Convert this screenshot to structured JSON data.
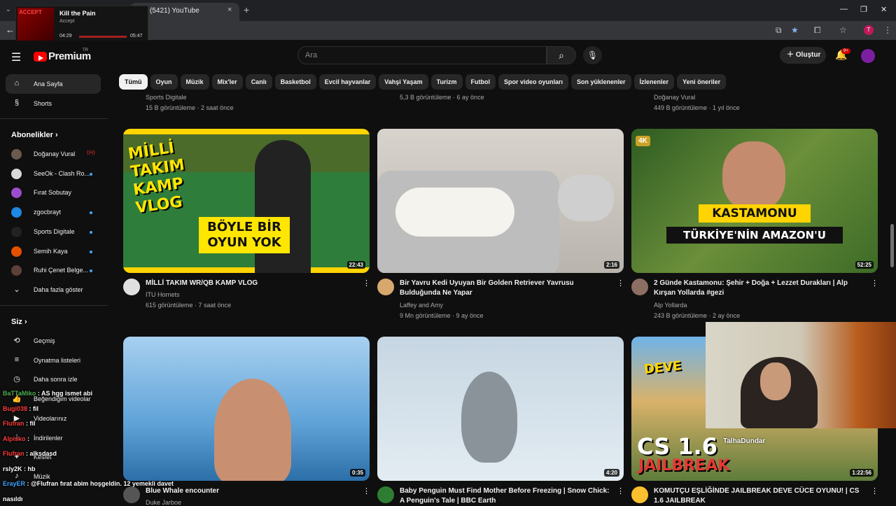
{
  "browser": {
    "tab_title": "(5421) YouTube",
    "tab_close": "×",
    "new_tab": "+",
    "window_minimize": "—",
    "window_restore": "❐",
    "window_close": "✕"
  },
  "now_playing": {
    "title": "Kill the Pain",
    "artist": "Accept",
    "elapsed": "04:29",
    "total": "05:47",
    "art_text": "ACCEPT",
    "progress_fraction": 0.77
  },
  "header": {
    "logo_text": "Premium",
    "logo_sup": "TR",
    "search_placeholder": "Ara",
    "create_label": "Oluştur",
    "notif_count": "9+"
  },
  "sidebar": {
    "main": [
      {
        "label": "Ana Sayfa",
        "icon": "home-icon"
      },
      {
        "label": "Shorts",
        "icon": "shorts-icon"
      }
    ],
    "subs_header": "Abonelikler",
    "subscriptions": [
      {
        "label": "Doğanay Vural",
        "status": "live",
        "color": "#6b5b4f"
      },
      {
        "label": "SeeOk - Clash Ro...",
        "status": "new",
        "color": "#d9d9d9"
      },
      {
        "label": "Fırat Sobutay",
        "status": "",
        "color": "#9c4dcc"
      },
      {
        "label": "zgocbrayt",
        "status": "new",
        "color": "#1e88e5"
      },
      {
        "label": "Sports Digitale",
        "status": "new",
        "color": "#222"
      },
      {
        "label": "Semih Kaya",
        "status": "new",
        "color": "#e65100"
      },
      {
        "label": "Ruhi Çenet Belge...",
        "status": "new",
        "color": "#5d4037"
      }
    ],
    "show_more": "Daha fazla göster",
    "you_header": "Siz",
    "you_items": [
      {
        "label": "Geçmiş",
        "icon": "history-icon"
      },
      {
        "label": "Oynatma listeleri",
        "icon": "playlist-icon"
      },
      {
        "label": "Daha sonra izle",
        "icon": "watch-later-icon"
      },
      {
        "label": "Beğendiğim videolar",
        "icon": "like-icon"
      },
      {
        "label": "Videolarınız",
        "icon": "video-icon"
      },
      {
        "label": "İndirilenler",
        "icon": "download-icon"
      },
      {
        "label": "Kesfet",
        "icon": "explore-icon"
      },
      {
        "label": "Müzik",
        "icon": "music-icon"
      }
    ]
  },
  "chips": [
    "Tümü",
    "Oyun",
    "Müzik",
    "Mix'ler",
    "Canlı",
    "Basketbol",
    "Evcil hayvanlar",
    "Vahşi Yaşam",
    "Turizm",
    "Futbol",
    "Spor video oyunları",
    "Son yüklenenler",
    "İzlenenler",
    "Yeni öneriler"
  ],
  "partial_top_row": [
    {
      "channel": "Sports Digitale",
      "meta": "15 B görüntüleme · 2 saat önce"
    },
    {
      "channel": "",
      "meta": "5,3 B görüntüleme · 6 ay önce"
    },
    {
      "channel": "Doğanay Vural",
      "meta": "449 B görüntüleme · 1 yıl önce"
    }
  ],
  "videos": [
    {
      "title": "MİLLİ TAKIM WR/QB KAMP VLOG",
      "channel": "ITU Hornets",
      "meta": "615 görüntüleme · 7 saat önce",
      "duration": "22:43",
      "thumb_text": "MİLLİ TAKIM KAMP VLOG",
      "thumb_text2": "BÖYLE BİR OYUN YOK",
      "avatar_color": "#e0e0e0"
    },
    {
      "title": "Bir Yavru Kedi Uyuyan Bir Golden Retriever Yavrusu Bulduğunda Ne Yapar",
      "channel": "Laffey and Amy",
      "meta": "9 Mn görüntüleme · 9 ay önce",
      "duration": "2:16",
      "avatar_color": "#d7a86e"
    },
    {
      "title": "2 Günde Kastamonu: Şehir + Doğa + Lezzet Durakları | Alp Kırşan Yollarda #gezi",
      "channel": "Alp Yollarda",
      "meta": "243 B görüntüleme · 2 ay önce",
      "duration": "52:25",
      "thumb_text": "KASTAMONU",
      "thumb_text2": "TÜRKİYE'NİN AMAZON'U",
      "badge": "4K",
      "avatar_color": "#8d6e63"
    },
    {
      "title": "Blue Whale encounter",
      "channel": "Duke Jarboe",
      "meta": "",
      "duration": "0:35",
      "avatar_color": "#555"
    },
    {
      "title": "Baby Penguin Must Find Mother Before Freezing | Snow Chick: A Penguin's Tale | BBC Earth",
      "channel": "",
      "meta": "",
      "duration": "4:20",
      "avatar_color": "#2e7d32"
    },
    {
      "title": "KOMUTÇU EŞLİĞİNDE JAILBREAK DEVE CÜCE OYUNU! | CS 1.6 JAILBREAK",
      "channel": "",
      "meta": "",
      "duration": "1:22:56",
      "thumb_text": "DEVE",
      "thumb_text2": "CS 1.6",
      "thumb_text3": "JAILBREAK",
      "avatar_color": "#fbc02d"
    }
  ],
  "overlay": {
    "cam_name": "TalhaDundar",
    "chat": [
      {
        "user": "BaTTaMiko",
        "msg": "AS hgg ismet abi",
        "color": "#4caf50"
      },
      {
        "user": "Bugi038",
        "msg": "fil",
        "color": "#ff3b3b"
      },
      {
        "user": "Flufran",
        "msg": "fil",
        "color": "#ff3b3b"
      },
      {
        "user": "Alpisko",
        "msg": "",
        "color": "#ff3b3b"
      },
      {
        "user": "Flufran",
        "msg": "alksdasd",
        "color": "#ff3b3b"
      },
      {
        "user": "rsly2K",
        "msg": "hb",
        "color": "#fff"
      },
      {
        "user": "ErayER",
        "msg": "@Flufran fırat abim hoşgeldin. 12 yemekli davet",
        "color": "#3ea6ff"
      },
      {
        "user": "",
        "msg": "nasıldı",
        "color": "#fff"
      }
    ]
  }
}
